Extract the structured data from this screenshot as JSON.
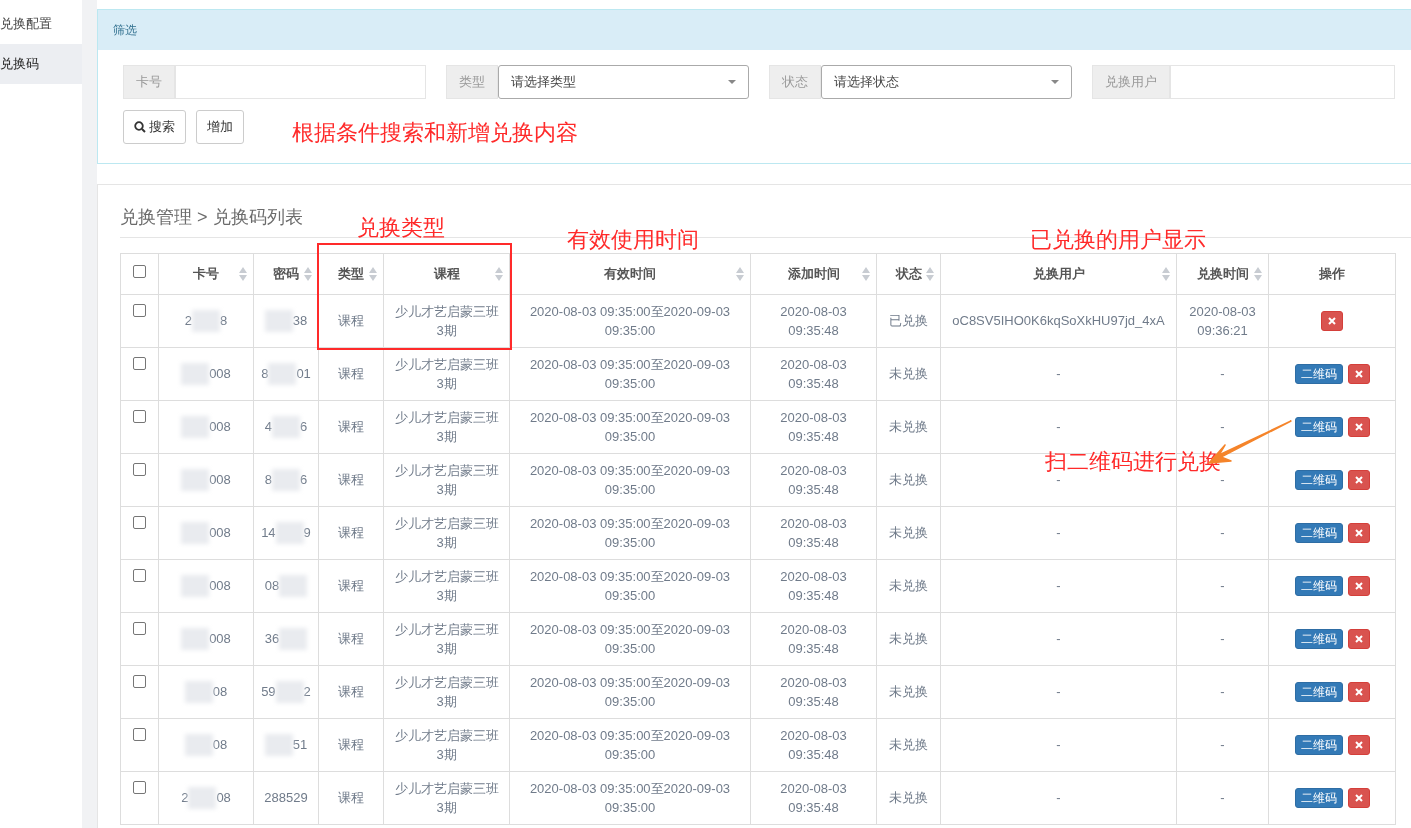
{
  "sidebar": {
    "items": [
      {
        "label": "兑换配置",
        "selected": false
      },
      {
        "label": "兑换码",
        "selected": true
      }
    ]
  },
  "filter": {
    "title": "筛选",
    "fields": [
      {
        "kind": "input",
        "label": "卡号"
      },
      {
        "kind": "select",
        "label": "类型",
        "placeholder": "请选择类型"
      },
      {
        "kind": "select",
        "label": "状态",
        "placeholder": "请选择状态"
      },
      {
        "kind": "input",
        "label": "兑换用户"
      }
    ],
    "buttons": [
      {
        "kind": "search",
        "label": "搜索"
      },
      {
        "kind": "plain",
        "label": "增加"
      }
    ]
  },
  "list": {
    "breadcrumb": "兑换管理 > 兑换码列表",
    "select_all": {
      "checked": false
    },
    "columns": [
      {
        "label": "卡号",
        "sortable": true
      },
      {
        "label": "密码",
        "sortable": true
      },
      {
        "label": "类型",
        "sortable": true
      },
      {
        "label": "课程",
        "sortable": true
      },
      {
        "label": "有效时间",
        "sortable": true
      },
      {
        "label": "添加时间",
        "sortable": true
      },
      {
        "label": "状态",
        "sortable": true
      },
      {
        "label": "兑换用户",
        "sortable": true
      },
      {
        "label": "兑换时间",
        "sortable": true
      },
      {
        "label": "操作",
        "sortable": false
      }
    ],
    "rows": [
      {
        "selected": false,
        "card": {
          "masked": true,
          "start": "2",
          "end": "8"
        },
        "password": {
          "masked": true,
          "end": "38"
        },
        "type": "课程",
        "course": "少儿才艺启蒙三班3期",
        "valid": "2020-08-03 09:35:00至2020-09-03 09:35:00",
        "added": "2020-08-03 09:35:48",
        "status": "已兑换",
        "user": "oC8SV5IHO0K6kqSoXkHU97jd_4xA",
        "redeem_time": "2020-08-03 09:36:21"
      },
      {
        "selected": false,
        "card": {
          "masked": true,
          "end": "008"
        },
        "password": {
          "masked": true,
          "start": "8",
          "end": "01"
        },
        "type": "课程",
        "course": "少儿才艺启蒙三班3期",
        "valid": "2020-08-03 09:35:00至2020-09-03 09:35:00",
        "added": "2020-08-03 09:35:48",
        "status": "未兑换",
        "user": "-",
        "redeem_time": "-",
        "qr_label": "二维码"
      },
      {
        "selected": false,
        "card": {
          "masked": true,
          "end": "008"
        },
        "password": {
          "masked": true,
          "start": "4",
          "end": "6"
        },
        "type": "课程",
        "course": "少儿才艺启蒙三班3期",
        "valid": "2020-08-03 09:35:00至2020-09-03 09:35:00",
        "added": "2020-08-03 09:35:48",
        "status": "未兑换",
        "user": "-",
        "redeem_time": "-",
        "qr_label": "二维码"
      },
      {
        "selected": false,
        "card": {
          "masked": true,
          "end": "008"
        },
        "password": {
          "masked": true,
          "start": "8",
          "end": "6"
        },
        "type": "课程",
        "course": "少儿才艺启蒙三班3期",
        "valid": "2020-08-03 09:35:00至2020-09-03 09:35:00",
        "added": "2020-08-03 09:35:48",
        "status": "未兑换",
        "user": "-",
        "redeem_time": "-",
        "qr_label": "二维码"
      },
      {
        "selected": false,
        "card": {
          "masked": true,
          "end": "008"
        },
        "password": {
          "masked": true,
          "start": "14",
          "end": "9"
        },
        "type": "课程",
        "course": "少儿才艺启蒙三班3期",
        "valid": "2020-08-03 09:35:00至2020-09-03 09:35:00",
        "added": "2020-08-03 09:35:48",
        "status": "未兑换",
        "user": "-",
        "redeem_time": "-",
        "qr_label": "二维码"
      },
      {
        "selected": false,
        "card": {
          "masked": true,
          "end": "008"
        },
        "password": {
          "masked": true,
          "start": "08"
        },
        "type": "课程",
        "course": "少儿才艺启蒙三班3期",
        "valid": "2020-08-03 09:35:00至2020-09-03 09:35:00",
        "added": "2020-08-03 09:35:48",
        "status": "未兑换",
        "user": "-",
        "redeem_time": "-",
        "qr_label": "二维码"
      },
      {
        "selected": false,
        "card": {
          "masked": true,
          "end": "008"
        },
        "password": {
          "masked": true,
          "start": "36"
        },
        "type": "课程",
        "course": "少儿才艺启蒙三班3期",
        "valid": "2020-08-03 09:35:00至2020-09-03 09:35:00",
        "added": "2020-08-03 09:35:48",
        "status": "未兑换",
        "user": "-",
        "redeem_time": "-",
        "qr_label": "二维码"
      },
      {
        "selected": false,
        "card": {
          "masked": true,
          "end": "08"
        },
        "password": {
          "masked": true,
          "start": "59",
          "end": "2"
        },
        "type": "课程",
        "course": "少儿才艺启蒙三班3期",
        "valid": "2020-08-03 09:35:00至2020-09-03 09:35:00",
        "added": "2020-08-03 09:35:48",
        "status": "未兑换",
        "user": "-",
        "redeem_time": "-",
        "qr_label": "二维码"
      },
      {
        "selected": false,
        "card": {
          "masked": true,
          "end": "08"
        },
        "password": {
          "masked": true,
          "end": "51"
        },
        "type": "课程",
        "course": "少儿才艺启蒙三班3期",
        "valid": "2020-08-03 09:35:00至2020-09-03 09:35:00",
        "added": "2020-08-03 09:35:48",
        "status": "未兑换",
        "user": "-",
        "redeem_time": "-",
        "qr_label": "二维码"
      },
      {
        "selected": false,
        "card": {
          "masked": true,
          "start": "2",
          "end": "08"
        },
        "password": {
          "masked": false,
          "start": "288529"
        },
        "type": "课程",
        "course": "少儿才艺启蒙三班3期",
        "valid": "2020-08-03 09:35:00至2020-09-03 09:35:00",
        "added": "2020-08-03 09:35:48",
        "status": "未兑换",
        "user": "-",
        "redeem_time": "-",
        "qr_label": "二维码"
      }
    ]
  },
  "annotations": {
    "filter_note": "根据条件搜索和新增兑换内容",
    "type_note": "兑换类型",
    "time_note": "有效使用时间",
    "user_note": "已兑换的用户显示",
    "qr_note": "扫二维码进行兑换"
  }
}
